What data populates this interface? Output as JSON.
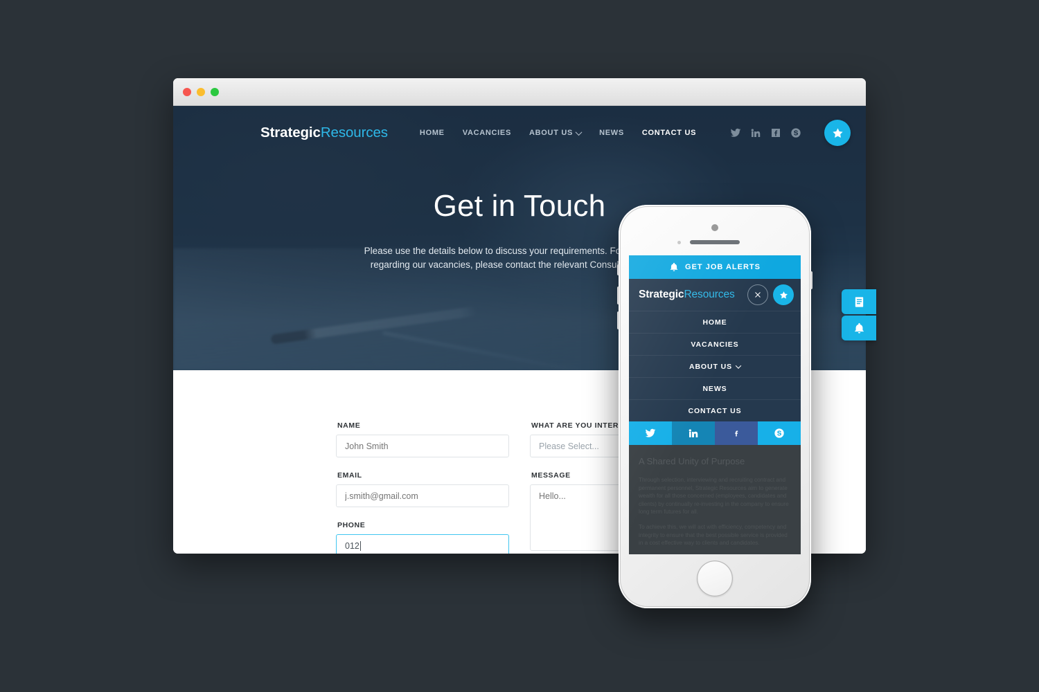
{
  "brand": {
    "part1": "Strategic",
    "part2": "Resources"
  },
  "colors": {
    "accent": "#19b5e8",
    "nav_bg": "#25394e",
    "hero_bg": "#24384d",
    "focus_border": "#40c6f0"
  },
  "browser": {
    "traffic_lights": [
      "close",
      "minimize",
      "zoom"
    ]
  },
  "desktop": {
    "nav_links": [
      {
        "label": "HOME",
        "active": false,
        "caret": false
      },
      {
        "label": "VACANCIES",
        "active": false,
        "caret": false
      },
      {
        "label": "ABOUT US",
        "active": false,
        "caret": true
      },
      {
        "label": "NEWS",
        "active": false,
        "caret": false
      },
      {
        "label": "CONTACT US",
        "active": true,
        "caret": false
      }
    ],
    "social": [
      "twitter-icon",
      "linkedin-icon",
      "facebook-icon",
      "skype-icon"
    ],
    "star_button": "star-icon",
    "hero": {
      "title": "Get in Touch",
      "sub_line1": "Please use the details below to discuss your requirements. For any queries",
      "sub_line2": "regarding our vacancies, please contact the relevant Consultant directly."
    },
    "form": {
      "name": {
        "label": "NAME",
        "placeholder": "John Smith",
        "value": ""
      },
      "email": {
        "label": "EMAIL",
        "placeholder": "j.smith@gmail.com",
        "value": ""
      },
      "phone": {
        "label": "PHONE",
        "placeholder": "",
        "value": "012",
        "focused": true
      },
      "interest": {
        "label": "WHAT ARE YOU INTERESTED IN?",
        "placeholder": "Please Select...",
        "value": ""
      },
      "message": {
        "label": "MESSAGE",
        "placeholder": "Hello...",
        "value": ""
      }
    },
    "side_tabs": [
      {
        "icon": "document-list-icon",
        "label": ""
      },
      {
        "icon": "bell-icon",
        "label": ""
      }
    ]
  },
  "phone": {
    "alerts_bar": {
      "icon": "bell-icon",
      "label": "GET JOB ALERTS"
    },
    "header": {
      "close": "close-icon",
      "star": "star-icon"
    },
    "menu": [
      {
        "label": "HOME",
        "caret": false
      },
      {
        "label": "VACANCIES",
        "caret": false
      },
      {
        "label": "ABOUT US",
        "caret": true
      },
      {
        "label": "NEWS",
        "caret": false
      },
      {
        "label": "CONTACT US",
        "caret": false
      }
    ],
    "social": [
      "twitter-icon",
      "linkedin-icon",
      "facebook-icon",
      "skype-icon"
    ],
    "content": {
      "heading": "A Shared Unity of Purpose",
      "para1": "Through selection, interviewing and recruiting contract and permanent personnel, Strategic Resources aim to generate wealth for all those concerned (employees, candidates and clients) by continually re-investing in the company to ensure long term futures for all.",
      "para2": "To achieve this, we will act with efficiency, competency and integrity to ensure that the best possible service is provided in a cost effective way to clients and candidates."
    }
  }
}
